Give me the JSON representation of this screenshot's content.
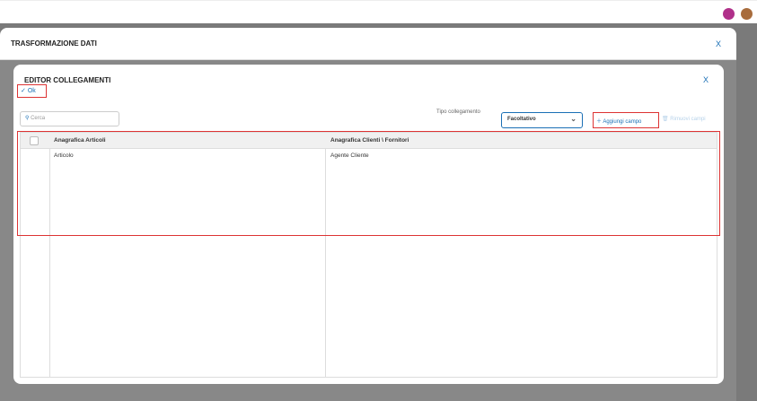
{
  "outer": {
    "title": "TRASFORMAZIONE DATI",
    "close": "X"
  },
  "inner": {
    "title": "EDITOR COLLEGAMENTI",
    "close": "X",
    "ok": "Ok",
    "search_placeholder": "Cerca",
    "tipo_label": "Tipo collegamento",
    "tipo_value": "Facoltativo",
    "add": "Aggiungi campo",
    "remove": "Rimuovi campi",
    "columns": [
      "Anagrafica Articoli",
      "Anagrafica Clienti \\ Fornitori"
    ],
    "rows": [
      [
        "Articolo",
        "Agente Cliente"
      ]
    ]
  }
}
